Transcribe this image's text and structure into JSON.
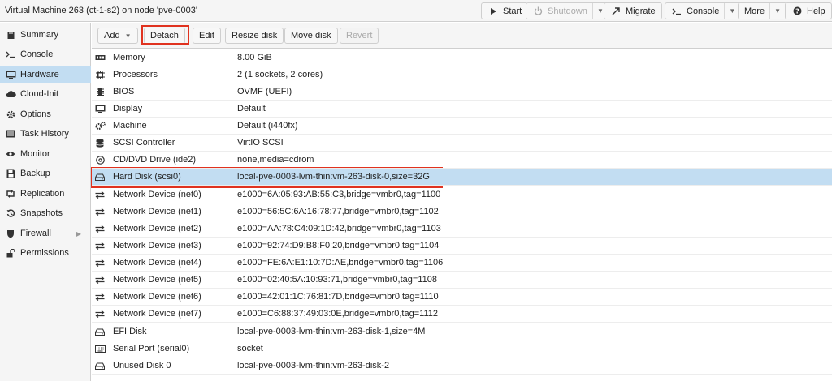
{
  "window": {
    "title": "Virtual Machine 263 (ct-1-s2) on node 'pve-0003'"
  },
  "topbar": {
    "buttons": [
      {
        "label": "Start",
        "icon": "play-icon",
        "disabled": false
      },
      {
        "label": "Shutdown",
        "icon": "power-icon",
        "disabled": true
      },
      {
        "label": "Migrate",
        "icon": "migrate-icon",
        "disabled": false
      },
      {
        "label": "Console",
        "icon": "terminal-icon",
        "disabled": false
      },
      {
        "label": "More",
        "icon": "",
        "disabled": false
      },
      {
        "label": "Help",
        "icon": "help-icon",
        "disabled": false
      }
    ]
  },
  "sidebar": {
    "items": [
      {
        "label": "Summary",
        "icon": "book-icon"
      },
      {
        "label": "Console",
        "icon": "terminal-icon"
      },
      {
        "label": "Hardware",
        "icon": "desktop-icon",
        "active": true
      },
      {
        "label": "Cloud-Init",
        "icon": "cloud-icon"
      },
      {
        "label": "Options",
        "icon": "gear-icon"
      },
      {
        "label": "Task History",
        "icon": "list-icon"
      },
      {
        "label": "Monitor",
        "icon": "eye-icon"
      },
      {
        "label": "Backup",
        "icon": "floppy-icon"
      },
      {
        "label": "Replication",
        "icon": "retweet-icon"
      },
      {
        "label": "Snapshots",
        "icon": "history-icon"
      },
      {
        "label": "Firewall",
        "icon": "shield-icon"
      },
      {
        "label": "Permissions",
        "icon": "unlock-icon"
      }
    ]
  },
  "toolbar": {
    "add_label": "Add",
    "detach_label": "Detach",
    "edit_label": "Edit",
    "resize_label": "Resize disk",
    "move_label": "Move disk",
    "revert_label": "Revert"
  },
  "hardware": {
    "rows": [
      {
        "icon": "memory-icon",
        "key": "Memory",
        "value": "8.00 GiB"
      },
      {
        "icon": "cpu-icon",
        "key": "Processors",
        "value": "2 (1 sockets, 2 cores)"
      },
      {
        "icon": "microchip-icon",
        "key": "BIOS",
        "value": "OVMF (UEFI)"
      },
      {
        "icon": "display-icon",
        "key": "Display",
        "value": "Default"
      },
      {
        "icon": "cogs-icon",
        "key": "Machine",
        "value": "Default (i440fx)"
      },
      {
        "icon": "database-icon",
        "key": "SCSI Controller",
        "value": "VirtIO SCSI"
      },
      {
        "icon": "cdrom-icon",
        "key": "CD/DVD Drive (ide2)",
        "value": "none,media=cdrom"
      },
      {
        "icon": "harddisk-icon",
        "key": "Hard Disk (scsi0)",
        "value": "local-pve-0003-lvm-thin:vm-263-disk-0,size=32G",
        "selected": true
      },
      {
        "icon": "network-icon",
        "key": "Network Device (net0)",
        "value": "e1000=6A:05:93:AB:55:C3,bridge=vmbr0,tag=1100"
      },
      {
        "icon": "network-icon",
        "key": "Network Device (net1)",
        "value": "e1000=56:5C:6A:16:78:77,bridge=vmbr0,tag=1102"
      },
      {
        "icon": "network-icon",
        "key": "Network Device (net2)",
        "value": "e1000=AA:78:C4:09:1D:42,bridge=vmbr0,tag=1103"
      },
      {
        "icon": "network-icon",
        "key": "Network Device (net3)",
        "value": "e1000=92:74:D9:B8:F0:20,bridge=vmbr0,tag=1104"
      },
      {
        "icon": "network-icon",
        "key": "Network Device (net4)",
        "value": "e1000=FE:6A:E1:10:7D:AE,bridge=vmbr0,tag=1106"
      },
      {
        "icon": "network-icon",
        "key": "Network Device (net5)",
        "value": "e1000=02:40:5A:10:93:71,bridge=vmbr0,tag=1108"
      },
      {
        "icon": "network-icon",
        "key": "Network Device (net6)",
        "value": "e1000=42:01:1C:76:81:7D,bridge=vmbr0,tag=1110"
      },
      {
        "icon": "network-icon",
        "key": "Network Device (net7)",
        "value": "e1000=C6:88:37:49:03:0E,bridge=vmbr0,tag=1112"
      },
      {
        "icon": "harddisk-icon",
        "key": "EFI Disk",
        "value": "local-pve-0003-lvm-thin:vm-263-disk-1,size=4M"
      },
      {
        "icon": "keyboard-icon",
        "key": "Serial Port (serial0)",
        "value": "socket"
      },
      {
        "icon": "harddisk-icon",
        "key": "Unused Disk 0",
        "value": "local-pve-0003-lvm-thin:vm-263-disk-2"
      }
    ]
  },
  "colors": {
    "selection": "#c2ddf2",
    "highlight_box": "#e0321f",
    "panel_bg": "#f5f5f5",
    "border": "#cfcfcf"
  }
}
